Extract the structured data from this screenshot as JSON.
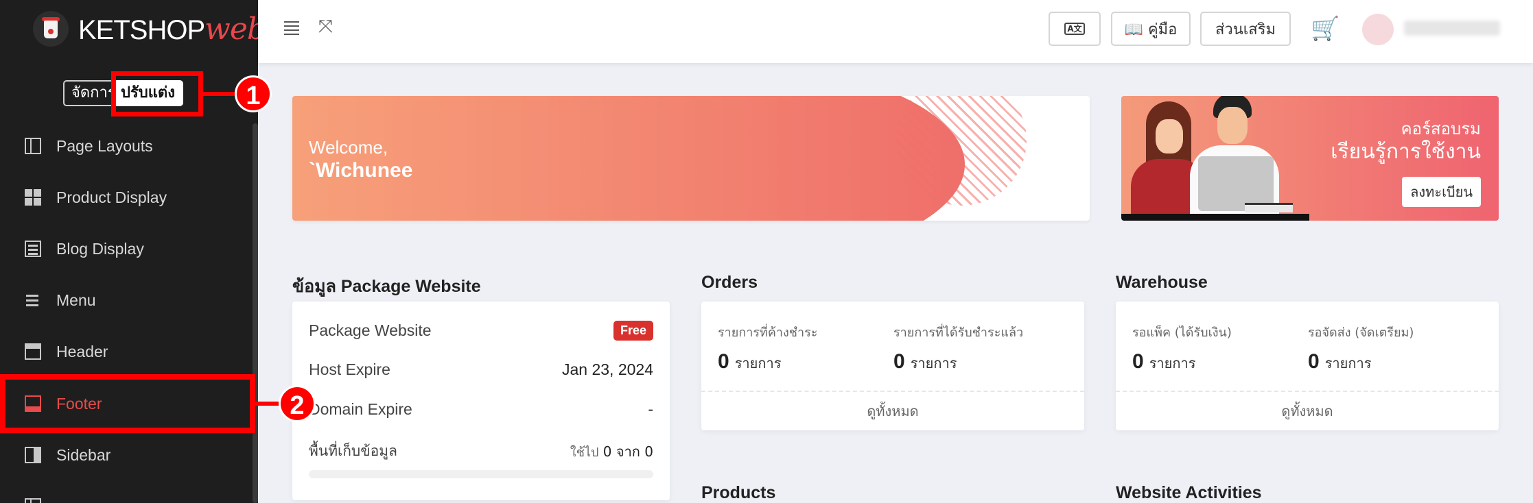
{
  "brand": {
    "ket": "KETSHOP",
    "web": "web"
  },
  "mode_switch": {
    "manage": "จัดการ",
    "customize": "ปรับแต่ง"
  },
  "callouts": {
    "one": "1",
    "two": "2"
  },
  "sidebar": {
    "items": [
      {
        "label": "Page Layouts",
        "icon": "page-layout-icon"
      },
      {
        "label": "Product Display",
        "icon": "grid-icon"
      },
      {
        "label": "Blog Display",
        "icon": "blog-icon"
      },
      {
        "label": "Menu",
        "icon": "menu-icon"
      },
      {
        "label": "Header",
        "icon": "header-icon"
      },
      {
        "label": "Footer",
        "icon": "footer-icon"
      },
      {
        "label": "Sidebar",
        "icon": "sidebar-icon"
      }
    ],
    "active_index": 5
  },
  "topbar": {
    "translate_icon": "translate-icon",
    "manual_label": "📖 คู่มือ",
    "addons_label": "ส่วนเสริม",
    "cart_icon": "cart-icon"
  },
  "welcome": {
    "greeting": "Welcome,",
    "name": "`Wichunee"
  },
  "course_banner": {
    "line1": "คอร์สอบรม",
    "line2": "เรียนรู้การใช้งาน",
    "register": "ลงทะเบียน"
  },
  "package": {
    "title": "ข้อมูล Package Website",
    "plan_label": "Package Website",
    "plan_badge": "Free",
    "host_label": "Host Expire",
    "host_value": "Jan 23, 2024",
    "domain_label": "Domain Expire",
    "domain_value": "-",
    "storage_label": "พื้นที่เก็บข้อมูล",
    "storage_used_prefix": "ใช้ไป",
    "storage_used": "0",
    "storage_of": "จาก",
    "storage_total": "0",
    "storage_fraction": 0
  },
  "orders": {
    "title": "Orders",
    "pending_label": "รายการที่ค้างชำระ",
    "pending_value": "0",
    "paid_label": "รายการที่ได้รับชำระแล้ว",
    "paid_value": "0",
    "unit": "รายการ",
    "view_all": "ดูทั้งหมด"
  },
  "warehouse": {
    "title": "Warehouse",
    "packing_label": "รอแพ็ค (ได้รับเงิน)",
    "packing_value": "0",
    "shipping_label": "รอจัดส่ง (จัดเตรียม)",
    "shipping_value": "0",
    "unit": "รายการ",
    "view_all": "ดูทั้งหมด"
  },
  "sections": {
    "products": "Products",
    "activities": "Website Activities"
  },
  "colors": {
    "accent": "#d9312e",
    "highlight": "#ff0000",
    "sidebar_bg": "#1e1e1e"
  }
}
